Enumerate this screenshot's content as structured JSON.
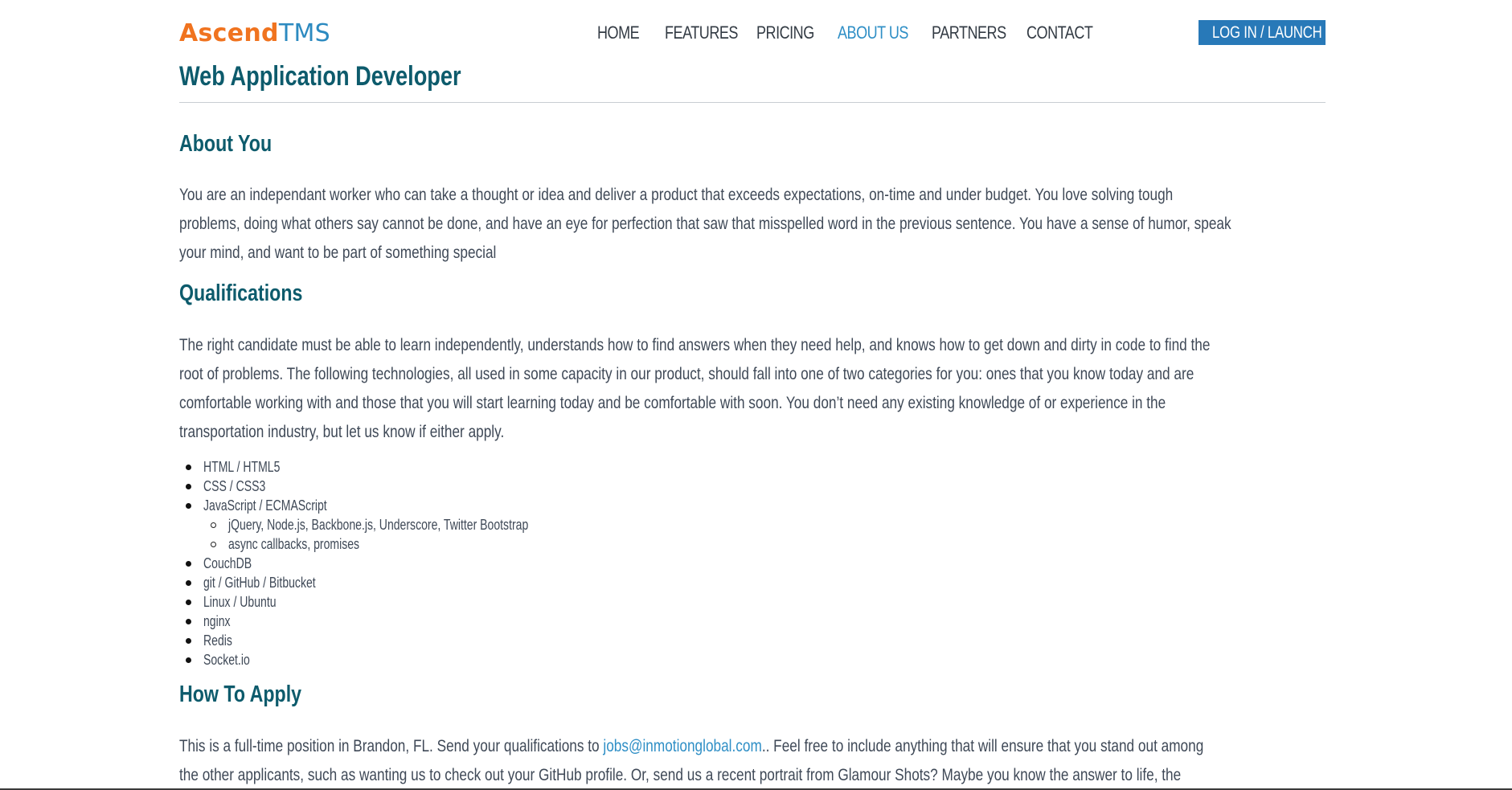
{
  "header": {
    "logo_ascend": "Ascend",
    "logo_tms": "TMS",
    "nav": [
      "HOME",
      "FEATURES",
      "PRICING",
      "ABOUT US",
      "PARTNERS",
      "CONTACT"
    ],
    "active_nav": "ABOUT US",
    "login_label": "LOG IN / LAUNCH"
  },
  "job": {
    "title": "Web Application Developer"
  },
  "about": {
    "heading": "About You",
    "lines": [
      "You are an independant worker who can take a thought or idea and deliver a product that exceeds expectations, on-time and under budget. You love solving tough",
      "problems, doing what others say cannot be done, and have an eye for perfection that saw that misspelled word in the previous sentence. You have a sense of humor, speak",
      "your mind, and want to be part of something special"
    ]
  },
  "qualifications": {
    "heading": "Qualifications",
    "lines": [
      "The right candidate must be able to learn independently, understands how to find answers when they need help, and knows how to get down and dirty in code to find the",
      "root of problems. The following technologies, all used in some capacity in our product, should fall into one of two categories for you: ones that you know today and are",
      "comfortable working with and those that you will start learning today and be comfortable with soon. You don’t need any existing knowledge of or experience in the",
      "transportation industry, but let us know if either apply."
    ],
    "tech": [
      "HTML / HTML5",
      "CSS / CSS3",
      "JavaScript / ECMAScript",
      "jQuery, Node.js, Backbone.js, Underscore, Twitter Bootstrap",
      "async callbacks, promises",
      "CouchDB",
      "git / GitHub / Bitbucket",
      "Linux / Ubuntu",
      "nginx",
      "Redis",
      "Socket.io"
    ]
  },
  "apply": {
    "heading": "How To Apply",
    "line1_before": "This is a full-time position in Brandon, FL. Send your qualifications to ",
    "email": "jobs@inmotionglobal.com",
    "line1_after": ".. Feel free to include anything that will ensure that you stand out among",
    "line2": "the other applicants, such as wanting us to check out your GitHub profile. Or, send us a recent portrait from Glamour Shots? Maybe you know the answer to life, the"
  },
  "colors": {
    "logo_orange": "#f0731f",
    "logo_blue": "#2c8ac0",
    "heading_teal": "#0d5b6c",
    "active_link": "#2f8fc6",
    "login_button_bg": "#2879b8",
    "body_text": "#3f4957"
  }
}
